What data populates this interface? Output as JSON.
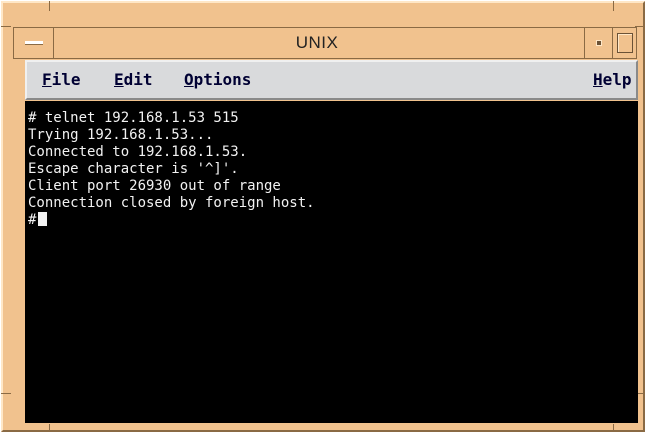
{
  "window": {
    "title": "UNIX"
  },
  "menubar": {
    "file": {
      "underline": "F",
      "rest": "ile"
    },
    "edit": {
      "underline": "E",
      "rest": "dit"
    },
    "options": {
      "underline": "O",
      "rest": "ptions"
    },
    "help": {
      "underline": "H",
      "rest": "elp"
    }
  },
  "terminal": {
    "lines": [
      "# telnet 192.168.1.53 515",
      "Trying 192.168.1.53...",
      "Connected to 192.168.1.53.",
      "Escape character is '^]'.",
      "Client port 26930 out of range",
      "Connection closed by foreign host."
    ],
    "prompt": "#"
  },
  "colors": {
    "frame": "#f1c28e",
    "menubar": "#d9dadc",
    "terminal_bg": "#000000",
    "terminal_fg": "#f2f2f2"
  },
  "icons": {
    "window_menu": "window-menu-icon",
    "minimize": "minimize-icon",
    "maximize": "maximize-icon"
  }
}
